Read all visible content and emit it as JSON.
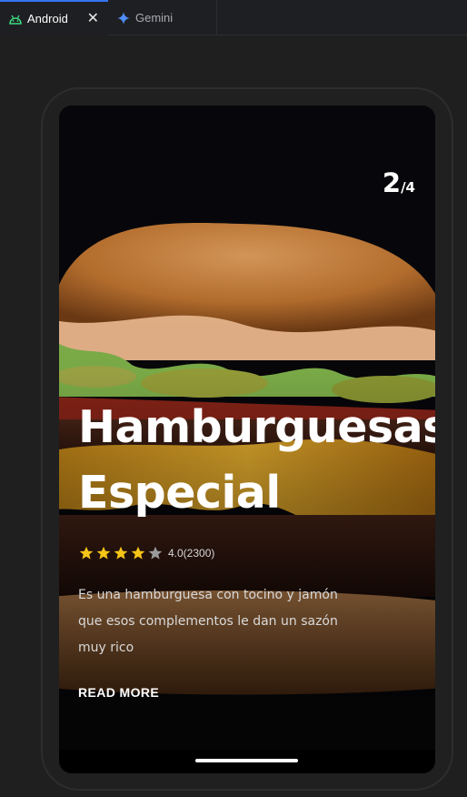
{
  "tabs": [
    {
      "label": "Android",
      "icon": "android-icon",
      "active": true,
      "close_glyph": "✕"
    },
    {
      "label": "Gemini",
      "icon": "gemini-sparkle-icon",
      "active": false
    }
  ],
  "card": {
    "index": "2",
    "total": "/4",
    "title_line1": "Hamburguesas",
    "title_line2": "Especial",
    "rating_value": 4.0,
    "rating_max": 5,
    "rating_text": "4.0(2300)",
    "description": "Es una hamburguesa con tocino y jamón que esos complementos le dan un sazón muy rico",
    "cta": "READ MORE"
  },
  "colors": {
    "accent": "#3574f0",
    "star_filled": "#f5c518",
    "star_empty": "#9a9a9a",
    "android_green": "#3ddc84",
    "gemini_blue": "#4f8df7"
  }
}
